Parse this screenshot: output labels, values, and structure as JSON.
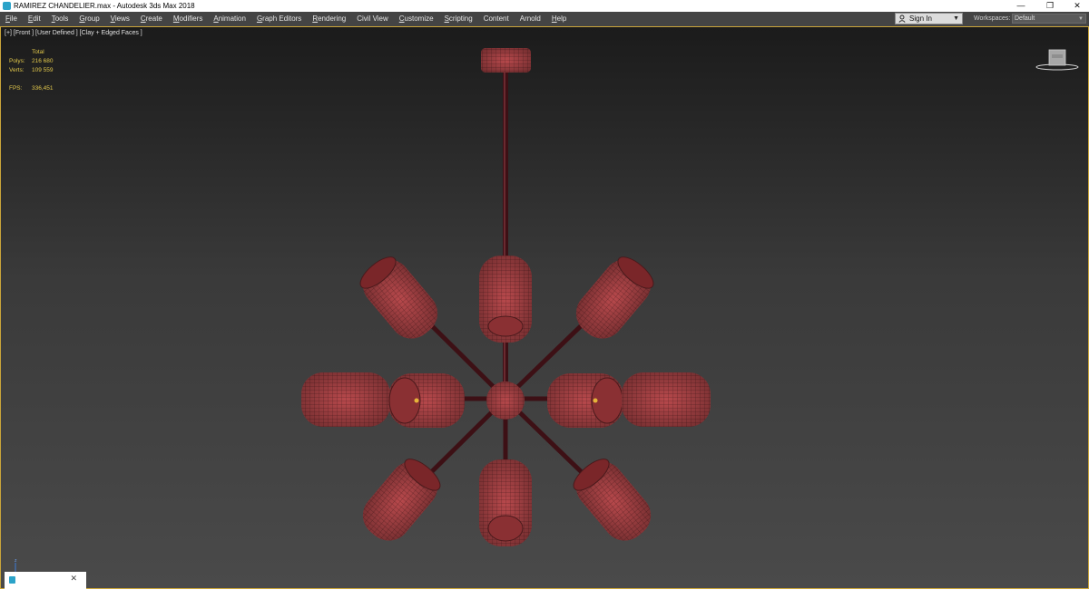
{
  "window": {
    "title": "RAMIREZ CHANDELIER.max - Autodesk 3ds Max 2018",
    "minimize_glyph": "—",
    "restore_glyph": "❐",
    "close_glyph": "✕"
  },
  "menu": [
    {
      "u": "F",
      "rest": "ile"
    },
    {
      "u": "E",
      "rest": "dit"
    },
    {
      "u": "T",
      "rest": "ools"
    },
    {
      "u": "G",
      "rest": "roup"
    },
    {
      "u": "V",
      "rest": "iews"
    },
    {
      "u": "C",
      "rest": "reate"
    },
    {
      "u": "M",
      "rest": "odifiers"
    },
    {
      "u": "A",
      "rest": "nimation"
    },
    {
      "u": "G",
      "rest": "raph Editors"
    },
    {
      "u": "R",
      "rest": "endering"
    },
    {
      "u": "",
      "rest": "Civil View"
    },
    {
      "u": "C",
      "rest": "ustomize"
    },
    {
      "u": "S",
      "rest": "cripting"
    },
    {
      "u": "",
      "rest": "Content"
    },
    {
      "u": "",
      "rest": "Arnold"
    },
    {
      "u": "H",
      "rest": "elp"
    }
  ],
  "signin": {
    "label": "Sign In",
    "caret": "▼"
  },
  "workspaces": {
    "label": "Workspaces:",
    "value": "Default",
    "caret": "▼"
  },
  "viewport": {
    "label": "[+] [Front ] [User Defined ] [Clay + Edged Faces ]",
    "stats": {
      "header": "Total",
      "polys_label": "Polys:",
      "polys": "216 680",
      "verts_label": "Verts:",
      "verts": "109 559",
      "fps_label": "FPS:",
      "fps": "336,451"
    },
    "axis_label": "z"
  },
  "mini_listener": {
    "close": "✕"
  },
  "colors": {
    "menubar": "#444444",
    "viewport_border": "#caa53a",
    "stats_text": "#e2c84b",
    "model": "#b8494c",
    "wire": "#4a1a1c",
    "rod": "#3d1015"
  }
}
